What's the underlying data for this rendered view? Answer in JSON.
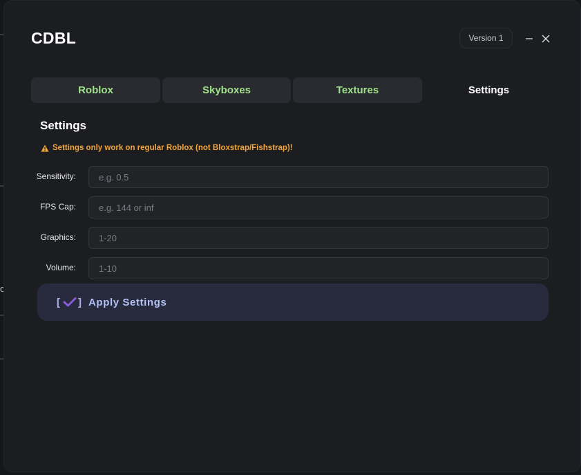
{
  "app": {
    "title": "CDBL",
    "version": "Version 1",
    "edge_glyph": "o"
  },
  "window_controls": {
    "minimize_icon": "minimize-icon",
    "close_icon": "close-icon"
  },
  "tabs": [
    {
      "label": "Roblox",
      "active": false
    },
    {
      "label": "Skyboxes",
      "active": false
    },
    {
      "label": "Textures",
      "active": false
    },
    {
      "label": "Settings",
      "active": true
    }
  ],
  "settings": {
    "title": "Settings",
    "warning": "Settings only work on regular Roblox (not Bloxstrap/Fishstrap)!",
    "fields": [
      {
        "label": "Sensitivity:",
        "value": "",
        "placeholder": "e.g. 0.5"
      },
      {
        "label": "FPS Cap:",
        "value": "",
        "placeholder": "e.g. 144 or inf"
      },
      {
        "label": "Graphics:",
        "value": "",
        "placeholder": "1-20"
      },
      {
        "label": "Volume:",
        "value": "",
        "placeholder": "1-10"
      }
    ],
    "apply": {
      "bracket_open": "[",
      "bracket_close": "]",
      "label": "Apply Settings",
      "icon": "checkmark-icon"
    }
  },
  "colors": {
    "accent_green": "#9fe08a",
    "warning_orange": "#f2a63a",
    "button_text": "#b3c0f2",
    "checkmark_purple": "#8a5ad8"
  }
}
